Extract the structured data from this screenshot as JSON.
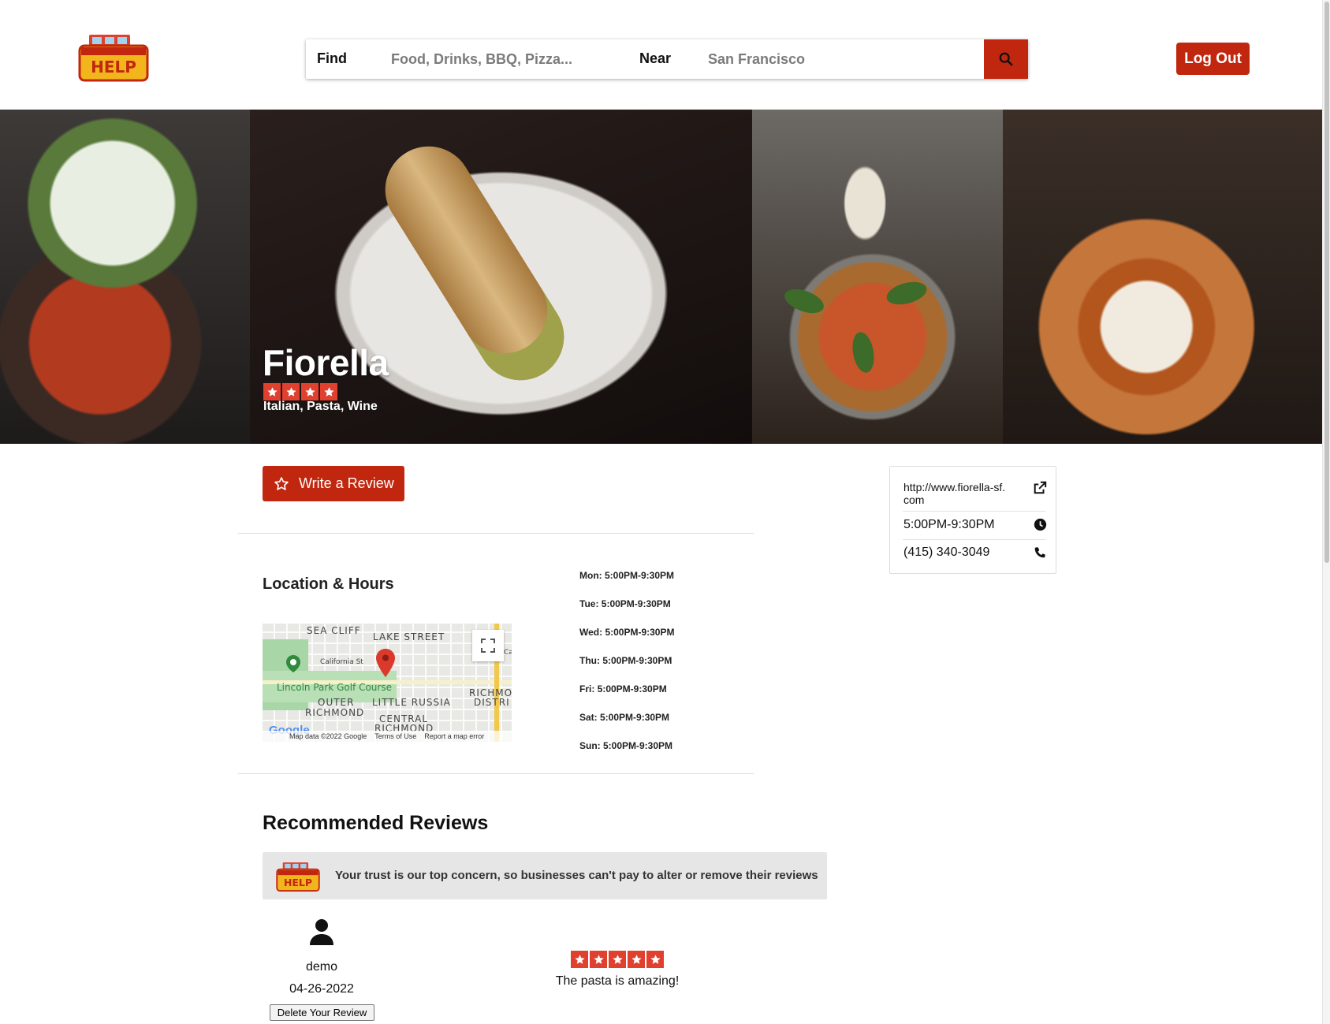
{
  "app": {
    "logo_alt": "help-logo"
  },
  "search": {
    "find_label": "Find",
    "find_placeholder": "Food, Drinks, BBQ, Pizza...",
    "near_label": "Near",
    "near_placeholder": "San Francisco"
  },
  "header": {
    "logout_label": "Log Out"
  },
  "business": {
    "name": "Fiorella",
    "rating": 4,
    "categories": "Italian, Pasta, Wine",
    "website": "http://www.fiorella-sf.com",
    "hours_today": "5:00PM-9:30PM",
    "phone": "(415) 340-3049"
  },
  "actions": {
    "write_review_label": "Write a Review"
  },
  "location": {
    "title": "Location & Hours",
    "map": {
      "labels": {
        "sea_cliff": "SEA CLIFF",
        "lake_street": "LAKE STREET",
        "california_st": "California St",
        "golf": "Lincoln Park Golf Course",
        "outer": "OUTER",
        "richmond": "RICHMOND",
        "little_russia": "LITTLE RUSSIA",
        "richmond_dist": "RICHMO",
        "distr": "DISTRI",
        "central": "CENTRAL",
        "richmond2": "RICHMOND",
        "ca": "Ca",
        "google": "Google"
      },
      "footer": {
        "data": "Map data ©2022 Google",
        "terms": "Terms of Use",
        "report": "Report a map error"
      }
    },
    "hours": [
      "Mon: 5:00PM-9:30PM",
      "Tue: 5:00PM-9:30PM",
      "Wed: 5:00PM-9:30PM",
      "Thu: 5:00PM-9:30PM",
      "Fri: 5:00PM-9:30PM",
      "Sat: 5:00PM-9:30PM",
      "Sun: 5:00PM-9:30PM"
    ]
  },
  "reviews": {
    "title": "Recommended Reviews",
    "trust_text": "Your trust is our top concern, so businesses can't pay to alter or remove their reviews",
    "items": [
      {
        "user": "demo",
        "date": "04-26-2022",
        "delete_label": "Delete Your Review",
        "rating": 5,
        "body": "The pasta is amazing!"
      }
    ]
  },
  "colors": {
    "brand": "#c1270e",
    "star": "#e0402e"
  }
}
